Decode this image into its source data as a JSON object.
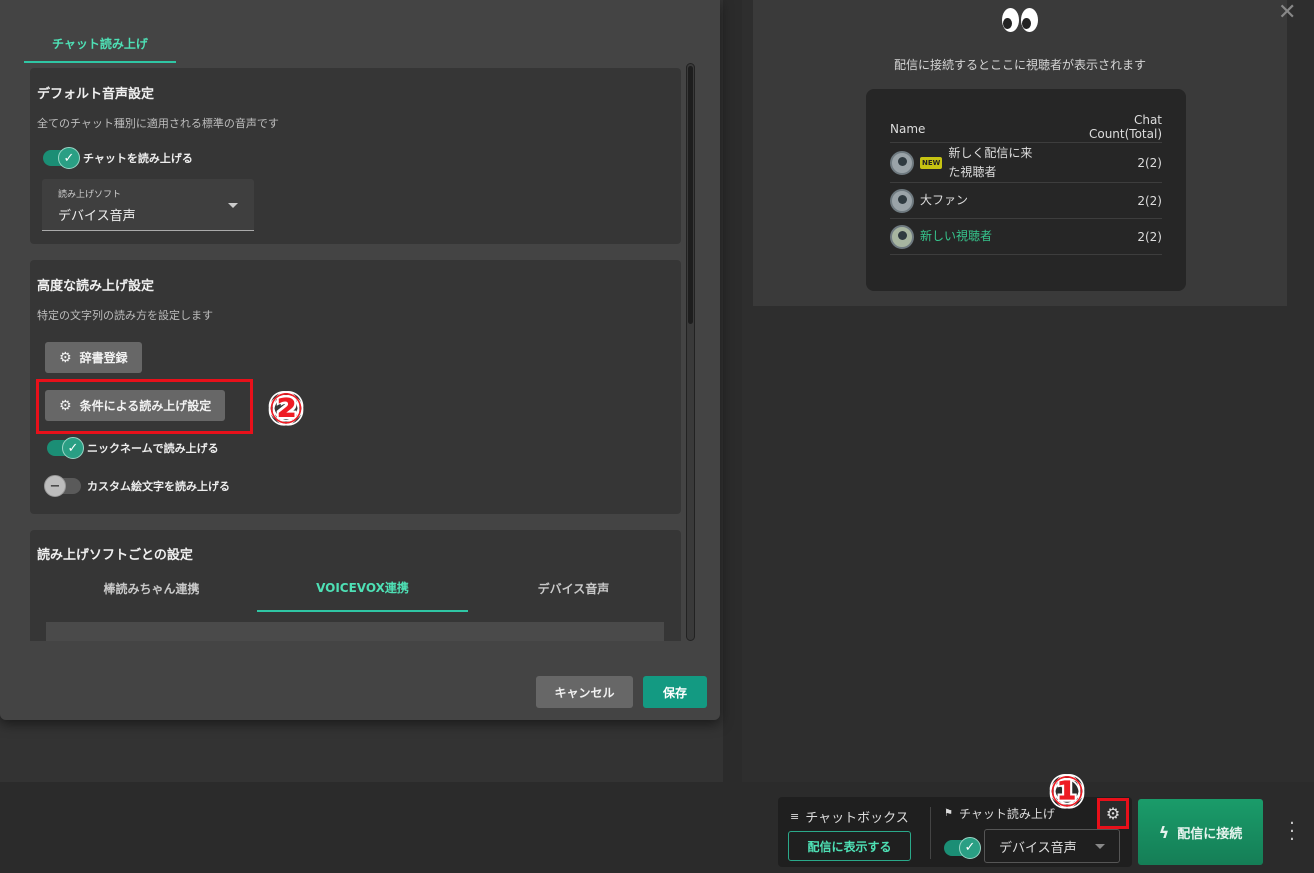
{
  "viewer": {
    "notice": "配信に接続するとここに視聴者が表示されます",
    "col_name": "Name",
    "col_count_line1": "Chat",
    "col_count_line2": "Count(Total)",
    "rows": [
      {
        "name": "新しく配信に来た視聴者",
        "name_line1": "新しく配信に来",
        "name_line2": "た視聴者",
        "badge": "NEW",
        "count": "2(2)"
      },
      {
        "name": "大ファン",
        "count": "2(2)"
      },
      {
        "name": "新しい視聴者",
        "count": "2(2)",
        "color": "#36c48c"
      }
    ],
    "close_icon": "close-icon"
  },
  "bottom": {
    "chatbox_label": "チャットボックス",
    "show_button": "配信に表示する",
    "tts_label": "チャット読み上げ",
    "tts_select": "デバイス音声",
    "connect_button": "配信に接続",
    "annotation_1": "①"
  },
  "modal": {
    "tab": "チャット読み上げ",
    "default_section": {
      "title": "デフォルト音声設定",
      "subtitle": "全てのチャット種別に適用される標準の音声です",
      "toggle_label": "チャットを読み上げる",
      "toggle_on": true,
      "select_label": "読み上げソフト",
      "select_value": "デバイス音声"
    },
    "advanced_section": {
      "title": "高度な読み上げ設定",
      "subtitle": "特定の文字列の読み方を設定します",
      "dictionary_button": "辞書登録",
      "condition_button": "条件による読み上げ設定",
      "nickname_toggle": "ニックネームで読み上げる",
      "nickname_on": true,
      "emoji_toggle": "カスタム絵文字を読み上げる",
      "emoji_on": false,
      "annotation_2": "②"
    },
    "software_section": {
      "title": "読み上げソフトごとの設定",
      "tabs": [
        "棒読みちゃん連携",
        "VOICEVOX連携",
        "デバイス音声"
      ],
      "active_tab": 1
    },
    "cancel": "キャンセル",
    "save": "保存"
  },
  "colors": {
    "accent": "#2fc6a4",
    "annotation_red": "#ee1c24",
    "save_bg": "#139a82"
  }
}
